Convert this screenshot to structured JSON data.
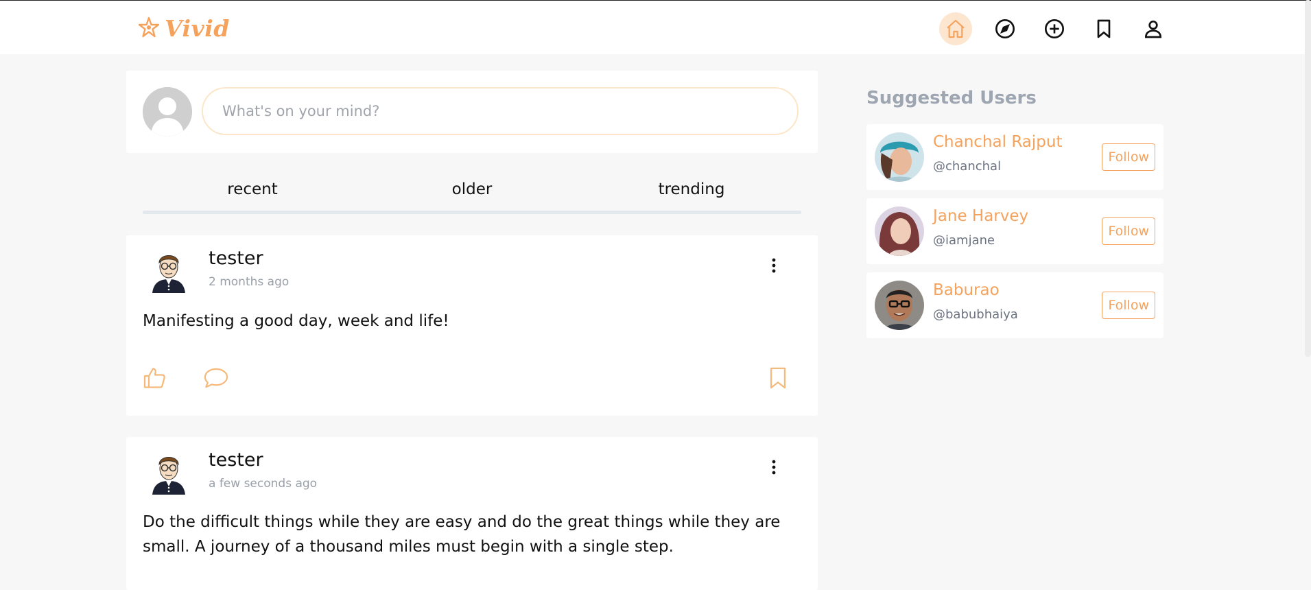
{
  "brand": {
    "name": "Vivid",
    "accent": "#f5a25d"
  },
  "nav": {
    "items": [
      {
        "name": "home",
        "icon": "home-icon",
        "active": true
      },
      {
        "name": "explore",
        "icon": "compass-icon",
        "active": false
      },
      {
        "name": "create",
        "icon": "plus-circle-icon",
        "active": false
      },
      {
        "name": "bookmarks",
        "icon": "bookmark-icon",
        "active": false
      },
      {
        "name": "profile",
        "icon": "user-icon",
        "active": false
      }
    ]
  },
  "composer": {
    "placeholder": "What's on your mind?"
  },
  "tabs": [
    "recent",
    "older",
    "trending"
  ],
  "posts": [
    {
      "user": "tester",
      "time": "2 months ago",
      "content": "Manifesting a good day, week and life!"
    },
    {
      "user": "tester",
      "time": "a few seconds ago",
      "content": "Do the difficult things while they are easy and do the great things while they are small. A journey of a thousand miles must begin with a single step."
    }
  ],
  "sidebar": {
    "title": "Suggested Users",
    "users": [
      {
        "name": "Chanchal Rajput",
        "handle": "@chanchal",
        "button": "Follow"
      },
      {
        "name": "Jane Harvey",
        "handle": "@iamjane",
        "button": "Follow"
      },
      {
        "name": "Baburao",
        "handle": "@babubhaiya",
        "button": "Follow"
      }
    ]
  }
}
